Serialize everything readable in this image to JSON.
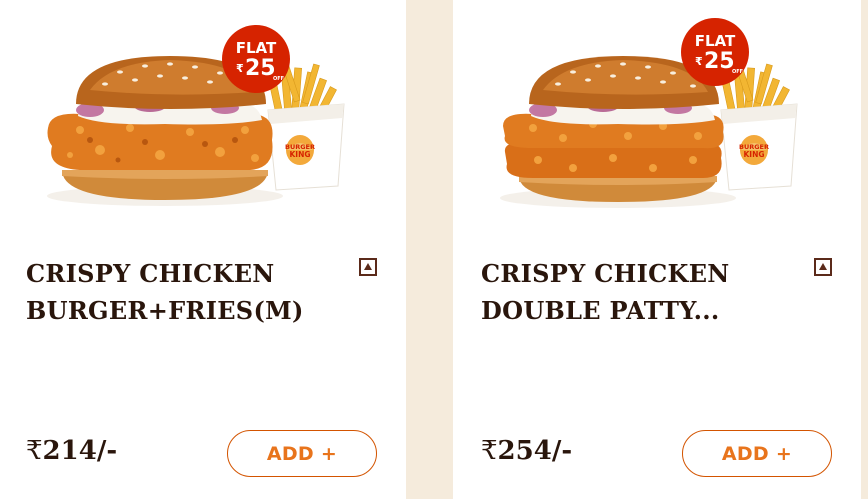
{
  "products": [
    {
      "title_line1": "CRISPY CHICKEN",
      "title_line2": "BURGER+FRIES(M)",
      "price_symbol": "₹",
      "price_value": "214/-",
      "add_label": "ADD +",
      "offer": {
        "line1": "FLAT",
        "symbol": "₹",
        "amount": "25",
        "suffix": "OFF"
      },
      "brand": {
        "line1": "BURGER",
        "line2": "KING"
      },
      "patties": 1
    },
    {
      "title_line1": "CRISPY CHICKEN",
      "title_line2": "DOUBLE PATTY...",
      "price_symbol": "₹",
      "price_value": "254/-",
      "add_label": "ADD +",
      "offer": {
        "line1": "FLAT",
        "symbol": "₹",
        "amount": "25",
        "suffix": "OFF"
      },
      "brand": {
        "line1": "BURGER",
        "line2": "KING"
      },
      "patties": 2
    }
  ],
  "colors": {
    "page_bg": "#f5ebdc",
    "title_text": "#2a160c",
    "accent_orange": "#e8741c",
    "offer_red": "#d62300",
    "nonveg_brown": "#5b2a1a"
  },
  "icons": [
    "non-veg-icon",
    "offer-badge",
    "burger-image",
    "fries-image"
  ]
}
